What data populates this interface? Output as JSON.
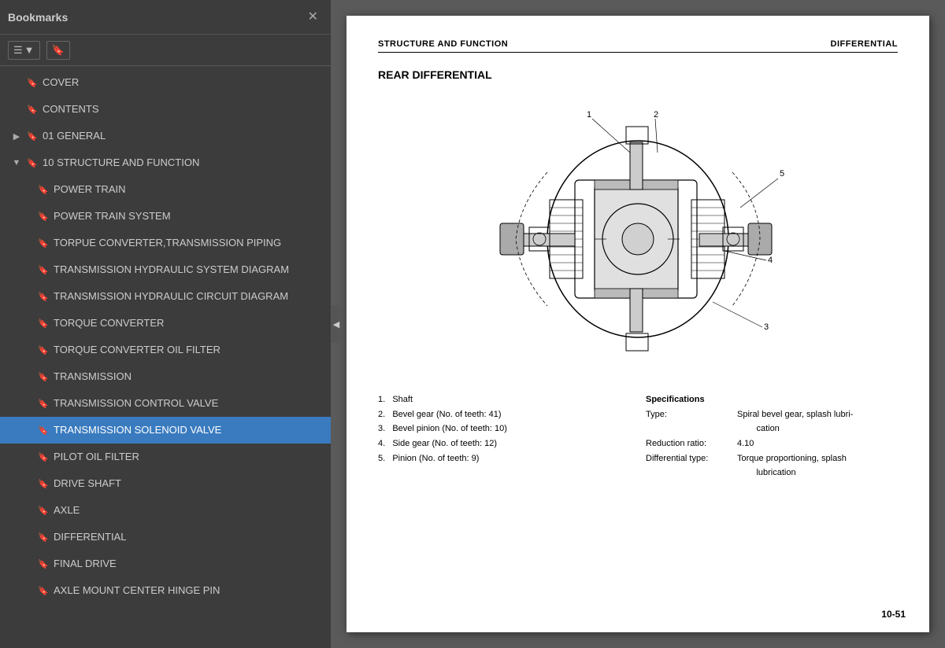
{
  "sidebar": {
    "title": "Bookmarks",
    "close_label": "✕",
    "toolbar": {
      "view_btn_icon": "☰▾",
      "bookmark_btn_icon": "🔖"
    },
    "items": [
      {
        "id": "cover",
        "label": "COVER",
        "level": 0,
        "expanded": false,
        "selected": false,
        "has_children": false
      },
      {
        "id": "contents",
        "label": "CONTENTS",
        "level": 0,
        "expanded": false,
        "selected": false,
        "has_children": false
      },
      {
        "id": "general",
        "label": "01 GENERAL",
        "level": 0,
        "expanded": false,
        "selected": false,
        "has_children": true,
        "expand_state": "collapsed"
      },
      {
        "id": "structure",
        "label": "10 STRUCTURE AND FUNCTION",
        "level": 0,
        "expanded": true,
        "selected": false,
        "has_children": true,
        "expand_state": "expanded"
      },
      {
        "id": "power-train",
        "label": "POWER TRAIN",
        "level": 1,
        "expanded": false,
        "selected": false,
        "has_children": false
      },
      {
        "id": "power-train-system",
        "label": "POWER TRAIN SYSTEM",
        "level": 1,
        "expanded": false,
        "selected": false,
        "has_children": false
      },
      {
        "id": "torque-converter-piping",
        "label": "TORPUE CONVERTER,TRANSMISSION PIPING",
        "level": 1,
        "expanded": false,
        "selected": false,
        "has_children": false
      },
      {
        "id": "transmission-hydraulic-system",
        "label": "TRANSMISSION HYDRAULIC SYSTEM DIAGRAM",
        "level": 1,
        "expanded": false,
        "selected": false,
        "has_children": false
      },
      {
        "id": "transmission-hydraulic-circuit",
        "label": "TRANSMISSION HYDRAULIC CIRCUIT DIAGRAM",
        "level": 1,
        "expanded": false,
        "selected": false,
        "has_children": false
      },
      {
        "id": "torque-converter",
        "label": "TORQUE CONVERTER",
        "level": 1,
        "expanded": false,
        "selected": false,
        "has_children": false
      },
      {
        "id": "torque-converter-oil-filter",
        "label": "TORQUE CONVERTER OIL FILTER",
        "level": 1,
        "expanded": false,
        "selected": false,
        "has_children": false
      },
      {
        "id": "transmission",
        "label": "TRANSMISSION",
        "level": 1,
        "expanded": false,
        "selected": false,
        "has_children": false
      },
      {
        "id": "transmission-control-valve",
        "label": "TRANSMISSION CONTROL VALVE",
        "level": 1,
        "expanded": false,
        "selected": false,
        "has_children": false
      },
      {
        "id": "transmission-solenoid-valve",
        "label": "TRANSMISSION SOLENOID VALVE",
        "level": 1,
        "expanded": false,
        "selected": true,
        "has_children": false
      },
      {
        "id": "pilot-oil-filter",
        "label": "PILOT OIL FILTER",
        "level": 1,
        "expanded": false,
        "selected": false,
        "has_children": false
      },
      {
        "id": "drive-shaft",
        "label": "DRIVE SHAFT",
        "level": 1,
        "expanded": false,
        "selected": false,
        "has_children": false
      },
      {
        "id": "axle",
        "label": "AXLE",
        "level": 1,
        "expanded": false,
        "selected": false,
        "has_children": false
      },
      {
        "id": "differential",
        "label": "DIFFERENTIAL",
        "level": 1,
        "expanded": false,
        "selected": false,
        "has_children": false
      },
      {
        "id": "final-drive",
        "label": "FINAL DRIVE",
        "level": 1,
        "expanded": false,
        "selected": false,
        "has_children": false
      },
      {
        "id": "axle-mount",
        "label": "AXLE MOUNT CENTER HINGE PIN",
        "level": 1,
        "expanded": false,
        "selected": false,
        "has_children": false
      }
    ]
  },
  "document": {
    "header_left": "STRUCTURE AND FUNCTION",
    "header_right": "DIFFERENTIAL",
    "section_title": "REAR DIFFERENTIAL",
    "page_number": "10-51",
    "specs": {
      "items_left": [
        "1.  Shaft",
        "2.  Bevel gear (No. of teeth: 41)",
        "3.  Bevel pinion (No. of teeth: 10)",
        "4.  Side gear (No. of teeth: 12)",
        "5.  Pinion (No. of teeth: 9)"
      ],
      "title_right": "Specifications",
      "rows_right": [
        {
          "label": "Type:",
          "value": "Spiral bevel gear, splash lubri-\n        cation"
        },
        {
          "label": "Reduction ratio:",
          "value": "4.10"
        },
        {
          "label": "Differential type:",
          "value": "Torque proportioning, splash\n        lubrication"
        }
      ]
    }
  }
}
